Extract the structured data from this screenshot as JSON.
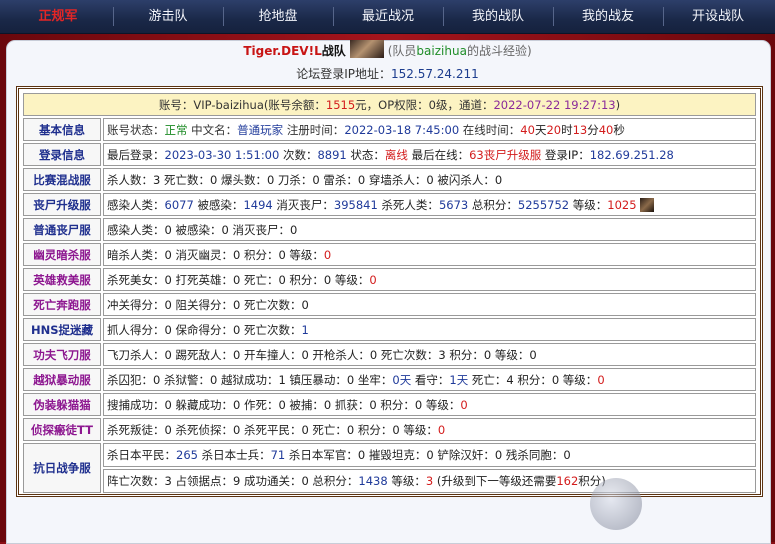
{
  "nav": {
    "items": [
      "正规军",
      "游击队",
      "抢地盘",
      "最近战况",
      "我的战队",
      "我的战友",
      "开设战队"
    ]
  },
  "header": {
    "team_name": "Tiger.DEV!L",
    "team_suffix": "战队",
    "note_prefix": "(队员",
    "note_user": "baizihua",
    "note_suffix": "的战斗经验)",
    "ip_label": "论坛登录IP地址：",
    "ip_value": "152.57.24.211"
  },
  "account": {
    "label": "账号：VIP-baizihua(账号余额：",
    "balance": "1515",
    "after_balance": "元，OP权限：0级，通道：",
    "datetime": "2022-07-22 19:27:13",
    "close": ")"
  },
  "rows": {
    "basic": {
      "label": "基本信息",
      "t1": "账号状态：",
      "status": "正常",
      "t2": "中文名：",
      "cname": "普通玩家",
      "t3": "注册时间：",
      "reg": "2022-03-18 7:45:00",
      "t4": "在线时间：",
      "d": "40",
      "du": "天",
      "h": "20",
      "hu": "时",
      "m": "13",
      "mu": "分",
      "s": "40",
      "su": "秒"
    },
    "login": {
      "label": "登录信息",
      "t1": "最后登录：",
      "last": "2023-03-30 1:51:00",
      "t2": "次数：",
      "count": "8891",
      "t3": "状态：",
      "state": "离线",
      "t4": "最后在线：",
      "where": "63丧尸升级服",
      "t5": "登录IP：",
      "ip": "182.69.251.28"
    },
    "mix": {
      "label": "比赛混战服",
      "text": "杀人数：3 死亡数：0 爆头数：0 刀杀：0 雷杀：0 穿墙杀人：0 被闪杀人：0"
    },
    "zombie_up": {
      "label": "丧尸升级服",
      "t1": "感染人类：",
      "v1": "6077",
      "t2": "被感染：",
      "v2": "1494",
      "t3": "消灭丧尸：",
      "v3": "395841",
      "t4": "杀死人类：",
      "v4": "5673",
      "t5": "总积分：",
      "v5": "5255752",
      "t6": "等级：",
      "v6": "1025"
    },
    "zombie_normal": {
      "label": "普通丧尸服",
      "text": "感染人类：0 被感染：0 消灭丧尸：0"
    },
    "ghost": {
      "label": "幽灵暗杀服",
      "text": "暗杀人类：0 消灭幽灵：0 积分：0 等级：",
      "lvl": "0"
    },
    "hero": {
      "label": "英雄救美服",
      "text": "杀死美女：0 打死英雄：0 死亡：0 积分：0 等级：",
      "lvl": "0"
    },
    "death": {
      "label": "死亡奔跑服",
      "text": "冲关得分：0 阻关得分：0 死亡次数：0"
    },
    "hns": {
      "label": "HNS捉迷藏",
      "text": "抓人得分：0 保命得分：0 死亡次数：",
      "lvl": "1"
    },
    "knife": {
      "label": "功夫飞刀服",
      "text": "飞刀杀人：0 踢死敌人：0 开车撞人：0 开枪杀人：0 死亡次数：3 积分：0 等级：0"
    },
    "jail": {
      "label": "越狱暴动服",
      "t1": "杀囚犯：0 杀狱警：0 越狱成功：1 镇压暴动：0 坐牢：",
      "v1": "0天",
      "t2": "看守：",
      "v2": "1天",
      "t3": "死亡：4 积分：0 等级：",
      "lvl": "0"
    },
    "hide": {
      "label": "伪装躲猫猫",
      "text": "搜捕成功：0 躲藏成功：0 作死：0 被捕：0 抓获：0 积分：0 等级：",
      "lvl": "0"
    },
    "detective": {
      "label": "侦探瘢徒TT",
      "text": "杀死叛徒：0 杀死侦探：0 杀死平民：0 死亡：0 积分：0 等级：",
      "lvl": "0"
    },
    "antiwar": {
      "label": "抗日战争服",
      "a1": "杀日本平民：",
      "a1v": "265",
      "a2": "杀日本士兵：",
      "a2v": "71",
      "a3": "杀日本军官：0 摧毁坦克：0 铲除汉奸：0 残杀同胞：0",
      "b1": "阵亡次数：3 占领据点：9 成功通关：0 总积分：",
      "b1v": "1438",
      "b2": "等级：",
      "b2v": "3",
      "b3": "(升级到下一等级还需要",
      "b3v": "162",
      "b4": "积分)"
    }
  },
  "colors": {
    "nav_bg": "#1a2848",
    "frame": "#8a0d14",
    "accent_red": "#d31c1c",
    "accent_blue": "#1f3a9a"
  }
}
